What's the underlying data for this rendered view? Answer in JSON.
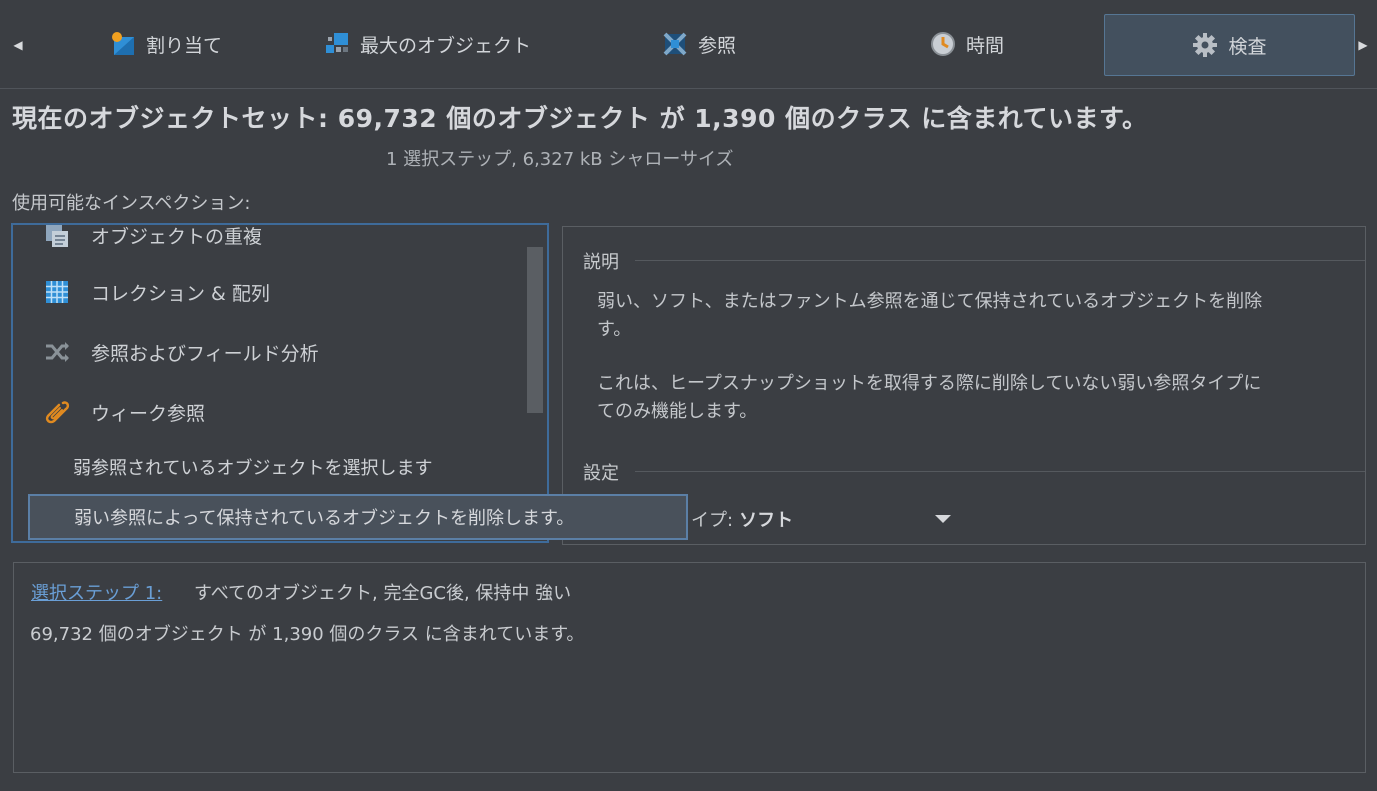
{
  "tabs": [
    {
      "label": "割り当て",
      "icon": "allocation-icon"
    },
    {
      "label": "最大のオブジェクト",
      "icon": "biggest-objects-icon"
    },
    {
      "label": "参照",
      "icon": "references-icon"
    },
    {
      "label": "時間",
      "icon": "time-icon"
    },
    {
      "label": "検査",
      "icon": "gear-icon",
      "active": true
    }
  ],
  "header": {
    "title": "現在のオブジェクトセット:  69,732 個のオブジェクト が 1,390 個のクラス に含まれています。",
    "subtitle": "1 選択ステップ, 6,327 kB シャローサイズ"
  },
  "inspections": {
    "label": "使用可能なインスペクション:",
    "items": [
      {
        "label": "オブジェクトの重複",
        "icon": "duplicate-objects-icon"
      },
      {
        "label": "コレクション & 配列",
        "icon": "collections-grid-icon"
      },
      {
        "label": "参照およびフィールド分析",
        "icon": "reference-analysis-icon"
      },
      {
        "label": "ウィーク参照",
        "icon": "weak-reference-icon"
      }
    ],
    "sub_options": [
      "弱参照されているオブジェクトを選択します",
      "弱い参照によって保持されているオブジェクトを削除します。"
    ]
  },
  "description": {
    "section_label": "説明",
    "paragraph1_line1": "弱い、ソフト、またはファントム参照を通じて保持されているオブジェクトを削除",
    "paragraph1_line2": "す。",
    "paragraph2_line1": "これは、ヒープスナップショットを取得する際に削除していない弱い参照タイプに",
    "paragraph2_line2": "てのみ機能します。"
  },
  "settings": {
    "section_label": "設定",
    "label_fragment": "イプ:",
    "value": "ソフト"
  },
  "bottom": {
    "step_link": "選択ステップ 1:",
    "step_desc": "すべてのオブジェクト, 完全GC後, 保持中 強い",
    "count": "69,732 個のオブジェクト が 1,390 個のクラス に含まれています。"
  },
  "colors": {
    "background": "#3b3e43",
    "accent_border": "#3e6b9a",
    "link": "#6a9fd6"
  }
}
